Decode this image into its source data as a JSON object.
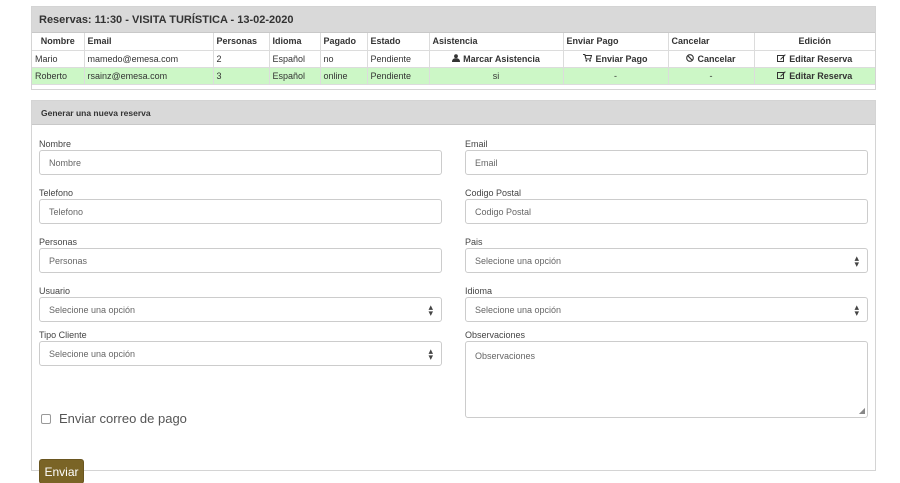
{
  "reservations": {
    "title": "Reservas: 11:30 - VISITA TURÍSTICA - 13-02-2020",
    "columns": [
      "Nombre",
      "Email",
      "Personas",
      "Idioma",
      "Pagado",
      "Estado",
      "Asistencia",
      "Enviar Pago",
      "Cancelar",
      "Edición"
    ],
    "rows": [
      {
        "nombre": "Mario",
        "email": "mamedo@emesa.com",
        "personas": "2",
        "idioma": "Español",
        "pagado": "no",
        "estado": "Pendiente",
        "asistencia": "Marcar Asistencia",
        "enviar_pago": "Enviar Pago",
        "cancelar": "Cancelar",
        "edicion": "Editar Reserva",
        "highlight": false
      },
      {
        "nombre": "Roberto",
        "email": "rsainz@emesa.com",
        "personas": "3",
        "idioma": "Español",
        "pagado": "online",
        "estado": "Pendiente",
        "asistencia": "si",
        "enviar_pago": "-",
        "cancelar": "-",
        "edicion": "Editar Reserva",
        "highlight": true
      }
    ]
  },
  "form": {
    "title": "Generar una nueva reserva",
    "nombre": {
      "label": "Nombre",
      "placeholder": "Nombre"
    },
    "email": {
      "label": "Email",
      "placeholder": "Email"
    },
    "telefono": {
      "label": "Telefono",
      "placeholder": "Telefono"
    },
    "codigo_postal": {
      "label": "Codigo Postal",
      "placeholder": "Codigo Postal"
    },
    "personas": {
      "label": "Personas",
      "placeholder": "Personas"
    },
    "pais": {
      "label": "Pais",
      "selected": "Selecione una opción"
    },
    "usuario": {
      "label": "Usuario",
      "selected": "Selecione una opción"
    },
    "idioma": {
      "label": "Idioma",
      "selected": "Selecione una opción"
    },
    "tipo_cliente": {
      "label": "Tipo Cliente",
      "selected": "Selecione una opción"
    },
    "observaciones": {
      "label": "Observaciones",
      "placeholder": "Observaciones"
    },
    "checkbox_label": "Enviar correo de pago",
    "submit_label": "Enviar"
  },
  "icons": {
    "asistencia": "user-icon",
    "enviar_pago": "cart-icon",
    "cancelar": "ban-icon",
    "edicion": "edit-icon",
    "select": "sort-caret-icon"
  },
  "colors": {
    "highlight_row": "#ccf7c6",
    "submit_button": "#7a6426",
    "panel_heading": "#d9d9d9"
  }
}
